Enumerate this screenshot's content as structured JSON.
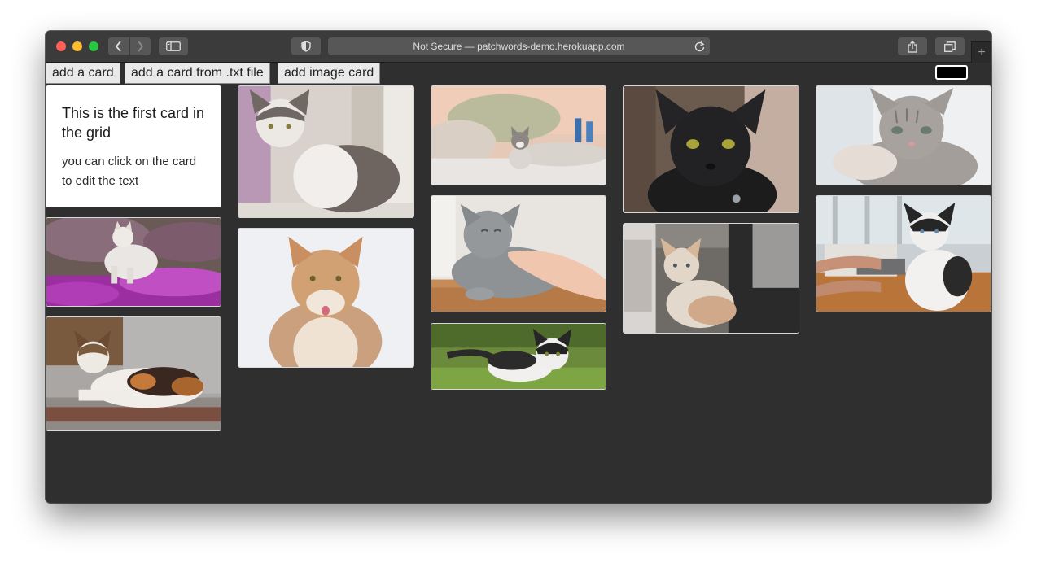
{
  "browser": {
    "url_text": "Not Secure — patchwords-demo.herokuapp.com"
  },
  "toolbar": {
    "add_card_label": "add a card",
    "add_txt_card_label": "add a card from .txt file",
    "add_image_card_label": "add image card",
    "color_swatch": "#000000"
  },
  "first_card": {
    "title": "This is the first card in the grid",
    "body": "you can click on the card to edit the text"
  },
  "image_cards": [
    "cat-on-purple-flowers",
    "calico-cat-crouching",
    "grey-white-cat-by-window",
    "ginger-long-haired-cat",
    "kitten-on-bed",
    "grey-cat-chin-scratch",
    "black-white-cat-in-grass",
    "black-cat-portrait",
    "cat-at-radiator-window",
    "grey-tabby-kitten",
    "black-white-cat-by-keyboard"
  ],
  "colors": {
    "page_bg": "#2f2f2f",
    "titlebar_bg": "#3b3b3b",
    "button_bg": "#e9e9e9"
  }
}
